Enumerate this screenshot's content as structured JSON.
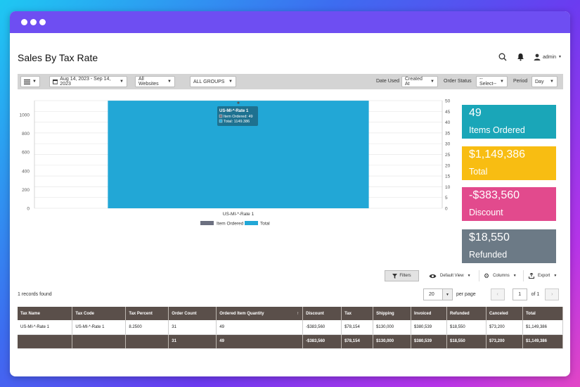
{
  "header": {
    "title": "Sales By Tax Rate",
    "user": "admin"
  },
  "toolbar": {
    "date_range": "Aug 14, 2023 - Sep 14, 2023",
    "websites": "All Websites",
    "groups": "ALL GROUPS",
    "date_used_label": "Date Used",
    "date_used_value": "Created At",
    "order_status_label": "Order Status",
    "order_status_value": "--Select--",
    "period_label": "Period",
    "period_value": "Day"
  },
  "chart_data": {
    "type": "bar",
    "categories": [
      "US-MI-*-Rate 1"
    ],
    "series": [
      {
        "name": "Item Ordered",
        "values": [
          49
        ],
        "axis": "right",
        "color": "#6c7080"
      },
      {
        "name": "Total",
        "values": [
          1149.386
        ],
        "axis": "left",
        "color": "#22a7d6"
      }
    ],
    "y_left": {
      "ticks": [
        0,
        200,
        400,
        600,
        800,
        1000
      ],
      "ylim": [
        0,
        1150
      ]
    },
    "y_right": {
      "ticks": [
        0,
        5,
        10,
        15,
        20,
        25,
        30,
        35,
        40,
        45,
        50
      ],
      "ylim": [
        0,
        50
      ]
    },
    "tooltip": {
      "title": "US-MI-*-Rate 1",
      "line1": "Item Ordered: 49",
      "line2": "Total: 1149.386"
    },
    "legend": "bottom-center",
    "grid": true
  },
  "cards": [
    {
      "value": "49",
      "label": "Items Ordered",
      "color": "#1aa6b8"
    },
    {
      "value": "$1,149,386",
      "label": "Total",
      "color": "#f8bd12"
    },
    {
      "value": "-$383,560",
      "label": "Discount",
      "color": "#e24a8d"
    },
    {
      "value": "$18,550",
      "label": "Refunded",
      "color": "#6c7a86"
    }
  ],
  "controls": {
    "filters": "Filters",
    "default_view": "Default View",
    "columns": "Columns",
    "export": "Export"
  },
  "records_found": "1 records found",
  "pager": {
    "page_size": "20",
    "per_page": "per page",
    "page": "1",
    "of": "of 1"
  },
  "table": {
    "headers": [
      "Tax Name",
      "Tax Code",
      "Tax Percent",
      "Order Count",
      "Ordered Item Quantity",
      "Discount",
      "Tax",
      "Shipping",
      "Invoiced",
      "Refunded",
      "Canceled",
      "Total"
    ],
    "rows": [
      [
        "US-MI-*-Rate 1",
        "US-MI-*-Rate 1",
        "8.2500",
        "31",
        "49",
        "-$383,560",
        "$78,154",
        "$130,000",
        "$380,539",
        "$18,550",
        "$73,200",
        "$1,149,386"
      ]
    ],
    "totals": [
      "",
      "",
      "",
      "31",
      "49",
      "-$383,560",
      "$78,154",
      "$130,000",
      "$380,539",
      "$18,550",
      "$73,200",
      "$1,149,386"
    ]
  }
}
